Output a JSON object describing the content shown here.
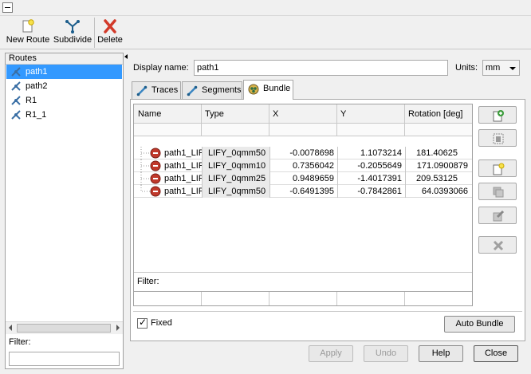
{
  "toolbar": {
    "new_route": "New Route",
    "subdivide": "Subdivide",
    "delete": "Delete"
  },
  "routes": {
    "header": "Routes",
    "items": [
      "path1",
      "path2",
      "R1",
      "R1_1"
    ],
    "selected": "path1",
    "filter_label": "Filter:",
    "filter_value": ""
  },
  "form": {
    "display_name_label": "Display name:",
    "display_name_value": "path1",
    "units_label": "Units:",
    "units_value": "mm"
  },
  "tabs": [
    {
      "label": "Traces",
      "icon": "traces-icon"
    },
    {
      "label": "Segments",
      "icon": "segments-icon"
    },
    {
      "label": "Bundle",
      "icon": "bundle-icon"
    }
  ],
  "active_tab": "Bundle",
  "table": {
    "headers": [
      "Name",
      "Type",
      "X",
      "Y",
      "Rotation [deg]"
    ],
    "rows": [
      {
        "name": "path1_LIF",
        "type": "LIFY_0qmm50",
        "x": "-0.0078698",
        "y": "1.1073214",
        "rotation": "181.40625"
      },
      {
        "name": "path1_LIF",
        "type": "LIFY_0qmm10",
        "x": "0.7356042",
        "y": "-0.2055649",
        "rotation": "171.0900879"
      },
      {
        "name": "path1_LIF",
        "type": "LIFY_0qmm25",
        "x": "0.9489659",
        "y": "-1.4017391",
        "rotation": "209.53125"
      },
      {
        "name": "path1_LIF",
        "type": "LIFY_0qmm50",
        "x": "-0.6491395",
        "y": "-0.7842861",
        "rotation": "64.0393066"
      }
    ],
    "filter_label": "Filter:"
  },
  "bundle": {
    "fixed_label": "Fixed",
    "fixed_checked": true,
    "auto_bundle": "Auto Bundle"
  },
  "footer": {
    "apply": "Apply",
    "undo": "Undo",
    "help": "Help",
    "close": "Close"
  },
  "colors": {
    "selection": "#3399ff",
    "wire_icon": "#c0392b",
    "delete_icon": "#d23a2a",
    "add_icon": "#3b9c3b"
  }
}
